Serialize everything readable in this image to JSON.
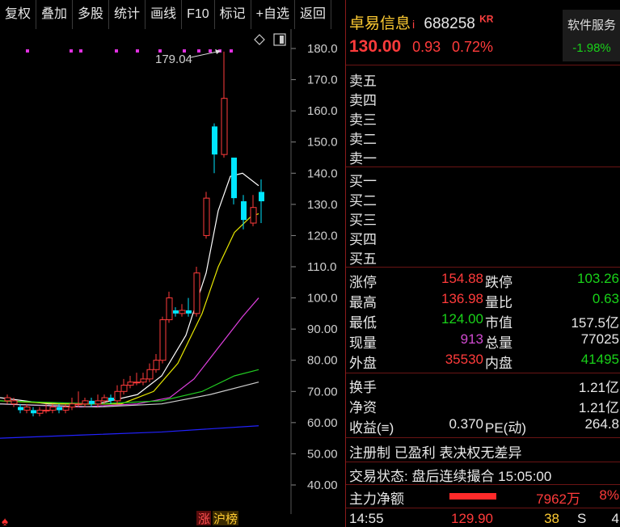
{
  "toolbar": {
    "items": [
      "复权",
      "叠加",
      "多股",
      "统计",
      "画线",
      "F10",
      "标记",
      "+自选",
      "返回"
    ]
  },
  "chart": {
    "max_label": "179.04",
    "y_ticks": [
      "180.0",
      "170.0",
      "160.0",
      "150.0",
      "140.0",
      "130.0",
      "120.0",
      "110.0",
      "100.0",
      "90.00",
      "80.00",
      "70.00",
      "60.00",
      "50.00",
      "40.00"
    ],
    "bottom_tags": [
      "涨",
      "沪榜"
    ]
  },
  "stock": {
    "name": "卓易信息",
    "info_mark": "i",
    "code": "688258",
    "tag": "KR",
    "price": "130.00",
    "change": "0.93",
    "change_pct": "0.72%",
    "sector_name": "软件服务",
    "sector_pct": "-1.98%"
  },
  "order_book": {
    "asks": [
      "卖五",
      "卖四",
      "卖三",
      "卖二",
      "卖一"
    ],
    "bids": [
      "买一",
      "买二",
      "买三",
      "买四",
      "买五"
    ]
  },
  "stats": {
    "limit_up_label": "涨停",
    "limit_up": "154.88",
    "limit_down_label": "跌停",
    "limit_down": "103.26",
    "high_label": "最高",
    "high": "136.98",
    "vol_ratio_label": "量比",
    "vol_ratio": "0.63",
    "low_label": "最低",
    "low": "124.00",
    "mkt_cap_label": "市值",
    "mkt_cap": "157.5亿",
    "cur_vol_label": "现量",
    "cur_vol": "913",
    "total_vol_label": "总量",
    "total_vol": "77025",
    "outer_label": "外盘",
    "outer": "35530",
    "inner_label": "内盘",
    "inner": "41495",
    "turnover_label": "换手",
    "turnover": "1.21亿",
    "net_asset_label": "净资",
    "net_asset": "1.21亿",
    "eps_label": "收益(≡)",
    "eps": "0.370",
    "pe_label": "PE(动)",
    "pe": "264.8"
  },
  "notes": {
    "tags": "注册制 已盈利 表决权无差异",
    "status": "交易状态: 盘后连续撮合 15:05:00",
    "main_flow_label": "主力净额",
    "main_flow": "7962万",
    "main_flow_pct": "8%"
  },
  "tick": {
    "time": "14:55",
    "price": "129.90",
    "volume": "38",
    "side": "S",
    "count": "4"
  },
  "colors": {
    "up": "#ff3b3b",
    "down": "#19d219",
    "ma5": "#ffffff",
    "ma10": "#e6e600",
    "ma20": "#e040e0",
    "ma60": "#22cc22",
    "ma120": "#2222ff"
  }
}
